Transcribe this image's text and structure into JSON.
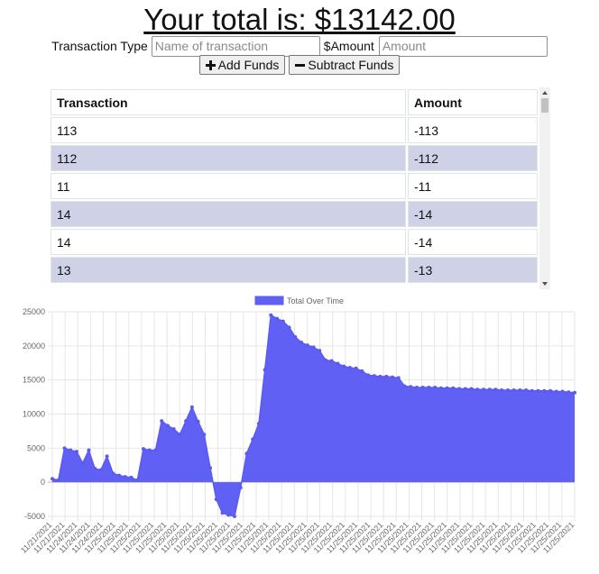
{
  "header": {
    "title": "Your total is: $13142.00"
  },
  "form": {
    "name_label": "Transaction Type",
    "name_placeholder": "Name of transaction",
    "amount_label": "$Amount",
    "amount_placeholder": "Amount"
  },
  "buttons": {
    "add_label": "Add Funds",
    "subtract_label": "Subtract Funds"
  },
  "table": {
    "headers": [
      "Transaction",
      "Amount"
    ],
    "rows": [
      {
        "name": "113",
        "amount": "-113"
      },
      {
        "name": "112",
        "amount": "-112"
      },
      {
        "name": "11",
        "amount": "-11"
      },
      {
        "name": "14",
        "amount": "-14"
      },
      {
        "name": "14",
        "amount": "-14"
      },
      {
        "name": "13",
        "amount": "-13"
      }
    ]
  },
  "colors": {
    "row_alt": "#cfd1e6",
    "chart_fill": "#6060f5",
    "chart_line": "#5b5bf0"
  },
  "chart_data": {
    "type": "area",
    "series": [
      {
        "name": "Total Over Time",
        "values": [
          500,
          300,
          5000,
          4700,
          4500,
          2800,
          4700,
          2000,
          1800,
          3800,
          1300,
          1000,
          800,
          700,
          300,
          4900,
          4700,
          4700,
          9000,
          8300,
          7800,
          7000,
          9000,
          11000,
          8900,
          7000,
          2100,
          -2500,
          -4500,
          -4800,
          -5000,
          -800,
          4200,
          6300,
          8600,
          16500,
          24500,
          24000,
          23600,
          22700,
          21300,
          20500,
          20100,
          19800,
          19300,
          17900,
          17800,
          17400,
          17000,
          16800,
          16700,
          16300,
          15700,
          15600,
          15500,
          15500,
          15400,
          15300,
          14100,
          14000,
          13900,
          13900,
          13900,
          13900,
          13800,
          13800,
          13800,
          13700,
          13700,
          13700,
          13600,
          13600,
          13600,
          13600,
          13500,
          13500,
          13500,
          13500,
          13500,
          13400,
          13400,
          13400,
          13400,
          13300,
          13300,
          13200,
          13142
        ]
      }
    ],
    "x_labels": [
      "11/21/2021",
      "11/21/2021",
      "11/24/2021",
      "11/24/2021",
      "11/24/2021",
      "11/25/2021",
      "11/25/2021",
      "11/25/2021",
      "11/25/2021",
      "11/25/2021",
      "11/25/2021",
      "11/25/2021",
      "11/25/2021",
      "11/25/2021",
      "11/25/2021",
      "11/25/2021",
      "11/25/2021",
      "11/25/2021",
      "11/25/2021",
      "11/25/2021",
      "11/25/2021",
      "11/25/2021",
      "11/25/2021",
      "11/25/2021",
      "11/25/2021",
      "11/25/2021",
      "11/25/2021",
      "11/25/2021",
      "11/25/2021",
      "11/25/2021",
      "11/25/2021",
      "11/25/2021",
      "11/25/2021",
      "11/25/2021",
      "11/25/2021",
      "11/25/2021",
      "11/25/2021",
      "11/25/2021",
      "11/25/2021",
      "11/25/2021",
      "11/25/2021",
      "11/25/2021"
    ],
    "y_ticks": [
      25000,
      20000,
      15000,
      10000,
      5000,
      0,
      -5000
    ],
    "ylim": [
      -5000,
      25000
    ],
    "legend_position": "top",
    "grid": true
  }
}
